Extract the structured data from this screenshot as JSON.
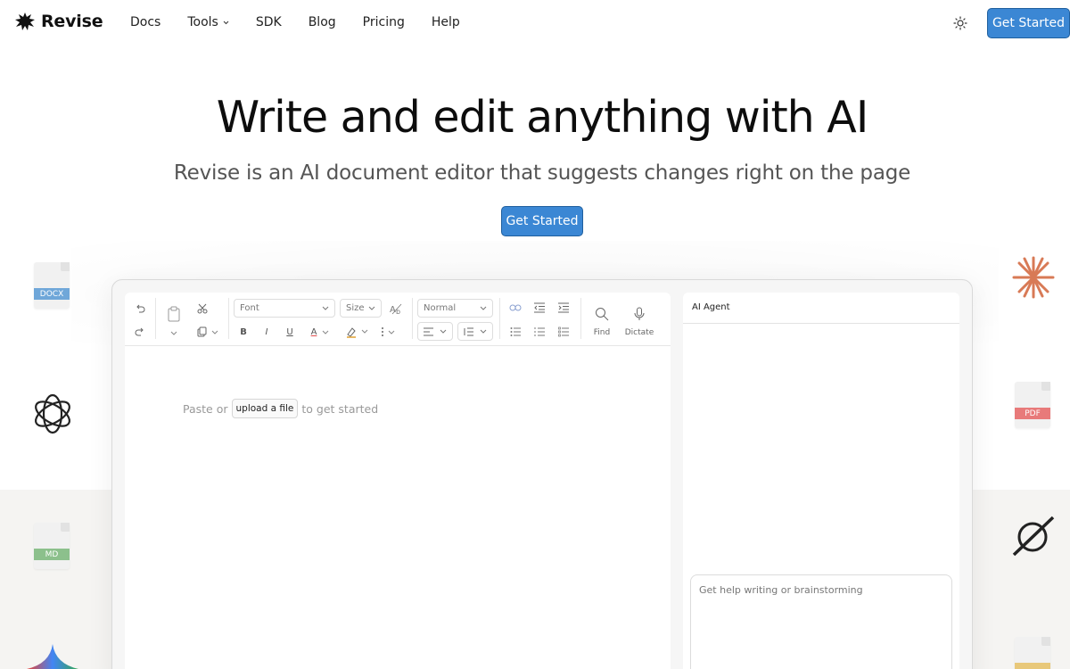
{
  "brand": {
    "name": "Revise"
  },
  "nav": {
    "links": [
      "Docs",
      "Tools",
      "SDK",
      "Blog",
      "Pricing",
      "Help"
    ],
    "cta": "Get Started"
  },
  "hero": {
    "title": "Write and edit anything with AI",
    "subtitle": "Revise is an AI document editor that suggests changes right on the page",
    "cta": "Get Started"
  },
  "side_icons": {
    "left": [
      "DOCX",
      "MD"
    ],
    "right": [
      "PDF"
    ]
  },
  "colors": {
    "accent": "#3b87d4",
    "docx": "#6fa7d9",
    "pdf": "#e87a7a",
    "md": "#8cc08c"
  },
  "editor": {
    "toolbar": {
      "font": "Font",
      "size": "Size",
      "style": "Normal",
      "find": "Find",
      "dictate": "Dictate",
      "bold": "B",
      "italic": "I",
      "underline": "U",
      "font_color": "A"
    },
    "placeholder_before": "Paste or",
    "upload": "upload a file",
    "placeholder_after": "to get started"
  },
  "ai_panel": {
    "title": "AI Agent",
    "input_placeholder": "Get help writing or brainstorming"
  }
}
